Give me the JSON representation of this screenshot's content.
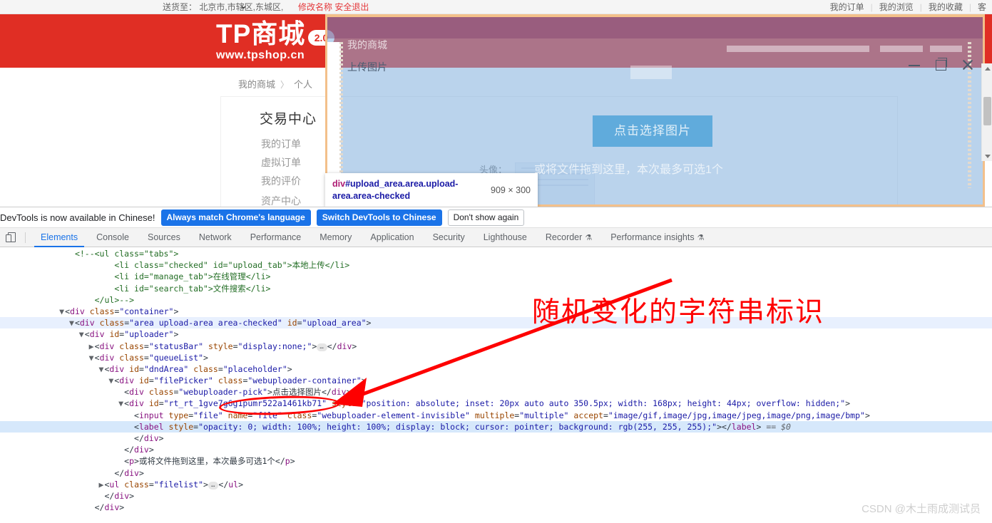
{
  "site": {
    "topbar": {
      "ship_to": "送货至： 北京市,市辖区,东城区,",
      "chevron_icon": "chevron-down-icon",
      "modify_name": "修改名称",
      "safe_logout": "安全退出",
      "links": [
        "我的订单",
        "我的浏览",
        "我的收藏",
        "客"
      ]
    },
    "header": {
      "logo_main": "TP商城",
      "logo_url": "www.tpshop.cn",
      "version_badge": "2.0",
      "brand_red": "#e02e24"
    },
    "breadcrumb": {
      "home": "我的商城",
      "separator": "〉",
      "current": "个人"
    },
    "sidebar": {
      "title": "交易中心",
      "items": [
        "我的订单",
        "虚拟订单",
        "我的评价",
        "资产中心"
      ]
    },
    "form": {
      "avatar_label": "头像："
    }
  },
  "modal": {
    "mall_name": "我的商城",
    "title": "上传图片",
    "pick_button": "点击选择图片",
    "drop_hint": "或将文件拖到这里，本次最多可选1个",
    "controls": {
      "minimize_icon": "minimize-icon",
      "maximize_icon": "maximize-icon",
      "close_icon": "close-icon"
    }
  },
  "element_tooltip": {
    "tag": "div",
    "selector": "#upload_area.area.upload-area.area-checked",
    "dimensions": "909 × 300"
  },
  "devtools": {
    "notice": {
      "message": "DevTools is now available in Chinese!",
      "buttons": [
        "Always match Chrome's language",
        "Switch DevTools to Chinese",
        "Don't show again"
      ]
    },
    "inspect_icon": "inspect-element-icon",
    "tabs": [
      {
        "label": "Elements",
        "active": true,
        "flask": false
      },
      {
        "label": "Console",
        "active": false,
        "flask": false
      },
      {
        "label": "Sources",
        "active": false,
        "flask": false
      },
      {
        "label": "Network",
        "active": false,
        "flask": false
      },
      {
        "label": "Performance",
        "active": false,
        "flask": false
      },
      {
        "label": "Memory",
        "active": false,
        "flask": false
      },
      {
        "label": "Application",
        "active": false,
        "flask": false
      },
      {
        "label": "Security",
        "active": false,
        "flask": false
      },
      {
        "label": "Lighthouse",
        "active": false,
        "flask": false
      },
      {
        "label": "Recorder",
        "active": false,
        "flask": true
      },
      {
        "label": "Performance insights",
        "active": false,
        "flask": true
      }
    ],
    "dom_lines": [
      {
        "indent": 7,
        "type": "comment",
        "text": "<!--<ul class=\"tabs\">"
      },
      {
        "indent": 11,
        "type": "comment",
        "text": "<li class=\"checked\" id=\"upload_tab\">本地上传</li>"
      },
      {
        "indent": 11,
        "type": "comment",
        "text": "<li id=\"manage_tab\">在线管理</li>"
      },
      {
        "indent": 11,
        "type": "comment",
        "text": "<li id=\"search_tab\">文件搜索</li>"
      },
      {
        "indent": 9,
        "type": "comment",
        "text": "</ul>-->"
      },
      {
        "indent": 6,
        "type": "open",
        "tri": true,
        "tag": "div",
        "attrs": [
          [
            "class",
            "container"
          ]
        ]
      },
      {
        "indent": 7,
        "type": "open",
        "tri": true,
        "tag": "div",
        "attrs": [
          [
            "class",
            "area upload-area area-checked"
          ],
          [
            "id",
            "upload_area"
          ]
        ],
        "hl": true
      },
      {
        "indent": 8,
        "type": "open",
        "tri": true,
        "tag": "div",
        "attrs": [
          [
            "id",
            "uploader"
          ]
        ]
      },
      {
        "indent": 9,
        "type": "collapsed",
        "tri": "right",
        "tag": "div",
        "attrs": [
          [
            "class",
            "statusBar"
          ],
          [
            "style",
            "display:none;"
          ]
        ]
      },
      {
        "indent": 9,
        "type": "open",
        "tri": true,
        "tag": "div",
        "attrs": [
          [
            "class",
            "queueList"
          ]
        ]
      },
      {
        "indent": 10,
        "type": "open",
        "tri": true,
        "tag": "div",
        "attrs": [
          [
            "id",
            "dndArea"
          ],
          [
            "class",
            "placeholder"
          ]
        ]
      },
      {
        "indent": 11,
        "type": "open",
        "tri": true,
        "tag": "div",
        "attrs": [
          [
            "id",
            "filePicker"
          ],
          [
            "class",
            "webuploader-container"
          ]
        ]
      },
      {
        "indent": 12,
        "type": "inline",
        "tag": "div",
        "attrs": [
          [
            "class",
            "webuploader-pick"
          ]
        ],
        "text": "点击选择图片"
      },
      {
        "indent": 12,
        "type": "open",
        "tri": true,
        "tag": "div",
        "attrs": [
          [
            "id",
            "rt_rt_1gve7g6g1pumr522a1461kb71"
          ],
          [
            "style",
            "position: absolute; inset: 20px auto auto 350.5px; width: 168px; height: 44px; overflow: hidden;"
          ]
        ]
      },
      {
        "indent": 13,
        "type": "void",
        "tag": "input",
        "attrs": [
          [
            "type",
            "file"
          ],
          [
            "name",
            "file"
          ],
          [
            "class",
            "webuploader-element-invisible"
          ],
          [
            "multiple",
            "multiple"
          ],
          [
            "accept",
            "image/gif,image/jpg,image/jpeg,image/png,image/bmp"
          ]
        ]
      },
      {
        "indent": 13,
        "type": "pair",
        "tag": "label",
        "attrs": [
          [
            "style",
            "opacity: 0; width: 100%; height: 100%; display: block; cursor: pointer; background: rgb(255, 255, 255);"
          ]
        ],
        "dollar": "== $0",
        "sel": true
      },
      {
        "indent": 13,
        "type": "close",
        "tag": "div"
      },
      {
        "indent": 12,
        "type": "close",
        "tag": "div"
      },
      {
        "indent": 12,
        "type": "inline",
        "tag": "p",
        "attrs": [],
        "text": "或将文件拖到这里，本次最多可选1个"
      },
      {
        "indent": 11,
        "type": "close",
        "tag": "div"
      },
      {
        "indent": 10,
        "type": "collapsed",
        "tri": "right",
        "tag": "ul",
        "attrs": [
          [
            "class",
            "filelist"
          ]
        ]
      },
      {
        "indent": 10,
        "type": "close",
        "tag": "div"
      },
      {
        "indent": 9,
        "type": "close",
        "tag": "div"
      }
    ]
  },
  "annotation": {
    "text": "随机变化的字符串标识",
    "color": "#fe0000"
  },
  "watermark": "CSDN @木土雨成测试员"
}
